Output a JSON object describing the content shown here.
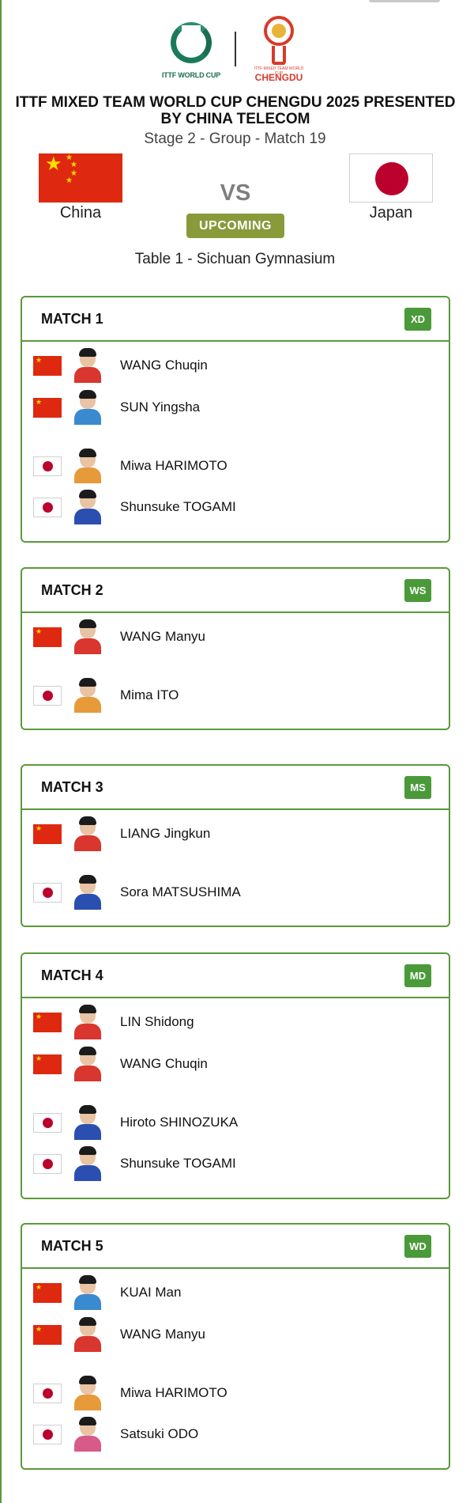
{
  "header": {
    "logo_left_text": "ITTF WORLD CUP",
    "logo_right_small": "ITTF MIXED TEAM WORLD CUP",
    "logo_right_text": "CHENGDU",
    "title": "ITTF MIXED TEAM WORLD CUP CHENGDU 2025 PRESENTED BY CHINA TELECOM",
    "subtitle": "Stage 2 - Group - Match 19"
  },
  "teams": {
    "home": {
      "name": "China"
    },
    "away": {
      "name": "Japan"
    },
    "vs_label": "VS",
    "status": "UPCOMING",
    "venue": "Table 1 - Sichuan Gymnasium"
  },
  "matches": [
    {
      "title": "MATCH 1",
      "event": "XD",
      "players": [
        {
          "name": "WANG Chuqin",
          "country": "cn",
          "kit": "red"
        },
        {
          "name": "SUN Yingsha",
          "country": "cn",
          "kit": "sky"
        },
        {
          "name": "Miwa HARIMOTO",
          "country": "jp",
          "kit": "orange"
        },
        {
          "name": "Shunsuke TOGAMI",
          "country": "jp",
          "kit": "blue"
        }
      ]
    },
    {
      "title": "MATCH 2",
      "event": "WS",
      "players": [
        {
          "name": "WANG Manyu",
          "country": "cn",
          "kit": "red"
        },
        {
          "name": "Mima ITO",
          "country": "jp",
          "kit": "orange"
        }
      ]
    },
    {
      "title": "MATCH 3",
      "event": "MS",
      "players": [
        {
          "name": "LIANG Jingkun",
          "country": "cn",
          "kit": "red"
        },
        {
          "name": "Sora MATSUSHIMA",
          "country": "jp",
          "kit": "blue"
        }
      ]
    },
    {
      "title": "MATCH 4",
      "event": "MD",
      "players": [
        {
          "name": "LIN Shidong",
          "country": "cn",
          "kit": "red"
        },
        {
          "name": "WANG Chuqin",
          "country": "cn",
          "kit": "red"
        },
        {
          "name": "Hiroto SHINOZUKA",
          "country": "jp",
          "kit": "blue"
        },
        {
          "name": "Shunsuke TOGAMI",
          "country": "jp",
          "kit": "blue"
        }
      ]
    },
    {
      "title": "MATCH 5",
      "event": "WD",
      "players": [
        {
          "name": "KUAI Man",
          "country": "cn",
          "kit": "sky"
        },
        {
          "name": "WANG Manyu",
          "country": "cn",
          "kit": "red"
        },
        {
          "name": "Miwa HARIMOTO",
          "country": "jp",
          "kit": "orange"
        },
        {
          "name": "Satsuki ODO",
          "country": "jp",
          "kit": "pink"
        }
      ]
    }
  ],
  "colors": {
    "accent_green": "#5a9a3a",
    "badge_green": "#4a9a3a",
    "status_olive": "#889a3a",
    "china_red": "#de2910",
    "japan_red": "#bc002d"
  }
}
